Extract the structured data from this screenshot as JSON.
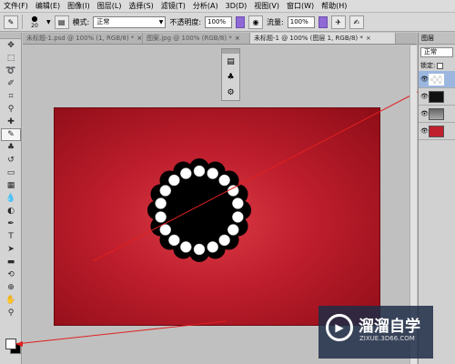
{
  "menu": [
    "文件(F)",
    "编辑(E)",
    "图像(I)",
    "图层(L)",
    "选择(S)",
    "滤镜(T)",
    "分析(A)",
    "3D(D)",
    "视图(V)",
    "窗口(W)",
    "帮助(H)"
  ],
  "options": {
    "brush_size": "20",
    "mode_label": "模式:",
    "mode_value": "正常",
    "opacity_label": "不透明度:",
    "opacity_value": "100%",
    "flow_label": "流量:",
    "flow_value": "100%"
  },
  "tabs": [
    {
      "label": "未标题-1.psd @ 100% (1, RGB/8) *",
      "close": "×"
    },
    {
      "label": "图案.jpg @ 100% (RGB/8) *",
      "close": "×"
    },
    {
      "label": "未标题-1 @ 100% (图层 1, RGB/8) *",
      "close": "×"
    }
  ],
  "layers_panel": {
    "tab_label": "图层",
    "blend_mode": "正常",
    "lock_label": "锁定:"
  },
  "watermark": {
    "title": "溜溜自学",
    "url": "ZIXUE.3D66.COM"
  },
  "colors": {
    "canvas_red": "#c01f2d",
    "foreground": "#ffffff",
    "background": "#000000",
    "annotation": "#e02020"
  }
}
